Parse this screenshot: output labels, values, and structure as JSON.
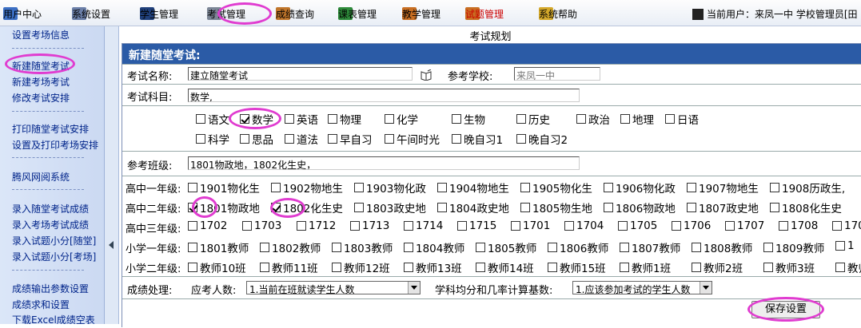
{
  "topnav": {
    "items": [
      {
        "label": "用户中心",
        "icon": "users-icon",
        "color": "#3b6fc4"
      },
      {
        "label": "系统设置",
        "icon": "settings-icon",
        "color": "#6b7fa8"
      },
      {
        "label": "学生管理",
        "icon": "student-icon",
        "color": "#1f3f7a"
      },
      {
        "label": "考试管理",
        "icon": "exam-icon",
        "color": "#7b8595"
      },
      {
        "label": "成绩查询",
        "icon": "score-icon",
        "color": "#c0752a"
      },
      {
        "label": "课表管理",
        "icon": "timetable-icon",
        "color": "#2d8a3a"
      },
      {
        "label": "教学管理",
        "icon": "teaching-icon",
        "color": "#c86e22"
      },
      {
        "label": "试题管理",
        "icon": "question-bank-icon",
        "color": "#c86e22"
      },
      {
        "label": "系统帮助",
        "icon": "help-icon",
        "color": "#d4a82a"
      }
    ],
    "user_info": "当前用户：来凤一中 学校管理员[田"
  },
  "sidebar": {
    "items": [
      "设置考场信息",
      "新建随堂考试",
      "新建考场考试",
      "修改考试安排",
      "打印随堂考试安排",
      "设置及打印考场安排",
      "腾风网阅系统",
      "录入随堂考试成绩",
      "录入考场考试成绩",
      "录入试题小分[随堂]",
      "录入试题小分[考场]",
      "成绩输出参数设置",
      "成绩求和设置",
      "下载Excel成绩空表"
    ]
  },
  "page": {
    "title": "考试规划",
    "panel_title": "新建随堂考试:",
    "exam_name_label": "考试名称:",
    "exam_name_value": "建立随堂考试",
    "school_label": "参考学校:",
    "school_value": "来凤一中",
    "subjects_label": "考试科目:",
    "subjects_value": "数学,",
    "classes_label": "参考班级:",
    "classes_value": "1801物政地，1802化生史，",
    "score_label": "成绩处理:",
    "exam_count_label": "应考人数:",
    "exam_count_value": "1.当前在班就读学生人数",
    "avg_label": "学科均分和几率计算基数:",
    "avg_value": "1.应该参加考试的学生人数",
    "save_label": "保存设置"
  },
  "subjects_row1": [
    {
      "label": "语文",
      "checked": false
    },
    {
      "label": "数学",
      "checked": true
    },
    {
      "label": "英语",
      "checked": false
    },
    {
      "label": "物理",
      "checked": false
    },
    {
      "label": "化学",
      "checked": false
    },
    {
      "label": "生物",
      "checked": false
    },
    {
      "label": "历史",
      "checked": false
    },
    {
      "label": "政治",
      "checked": false
    },
    {
      "label": "地理",
      "checked": false
    },
    {
      "label": "日语",
      "checked": false
    }
  ],
  "subjects_row2": [
    {
      "label": "科学",
      "checked": false
    },
    {
      "label": "思品",
      "checked": false
    },
    {
      "label": "道法",
      "checked": false
    },
    {
      "label": "早自习",
      "checked": false
    },
    {
      "label": "午间时光",
      "checked": false
    },
    {
      "label": "晚自习1",
      "checked": false
    },
    {
      "label": "晚自习2",
      "checked": false
    }
  ],
  "grades": [
    {
      "label": "高中一年级:",
      "classes": [
        {
          "label": "1901物化生",
          "checked": false
        },
        {
          "label": "1902物地生",
          "checked": false
        },
        {
          "label": "1903物化政",
          "checked": false
        },
        {
          "label": "1904物地生",
          "checked": false
        },
        {
          "label": "1905物化生",
          "checked": false
        },
        {
          "label": "1906物化政",
          "checked": false
        },
        {
          "label": "1907物地生",
          "checked": false
        },
        {
          "label": "1908历政生,",
          "checked": false
        }
      ]
    },
    {
      "label": "高中二年级:",
      "classes": [
        {
          "label": "1801物政地",
          "checked": true
        },
        {
          "label": "1802化生史",
          "checked": true
        },
        {
          "label": "1803政史地",
          "checked": false
        },
        {
          "label": "1804政史地",
          "checked": false
        },
        {
          "label": "1805物生地",
          "checked": false
        },
        {
          "label": "1806物政地",
          "checked": false
        },
        {
          "label": "1807政史地",
          "checked": false
        },
        {
          "label": "1808化生史",
          "checked": false
        }
      ]
    },
    {
      "label": "高中三年级:",
      "classes": [
        {
          "label": "1702",
          "checked": false
        },
        {
          "label": "1703",
          "checked": false
        },
        {
          "label": "1712",
          "checked": false
        },
        {
          "label": "1713",
          "checked": false
        },
        {
          "label": "1714",
          "checked": false
        },
        {
          "label": "1715",
          "checked": false
        },
        {
          "label": "1701",
          "checked": false
        },
        {
          "label": "1704",
          "checked": false
        },
        {
          "label": "1705",
          "checked": false
        },
        {
          "label": "1706",
          "checked": false
        },
        {
          "label": "1707",
          "checked": false
        },
        {
          "label": "1708",
          "checked": false
        },
        {
          "label": "1709",
          "checked": false
        },
        {
          "label": "1710,",
          "checked": false
        }
      ]
    },
    {
      "label": "小学一年级:",
      "classes": [
        {
          "label": "1801教师",
          "checked": false
        },
        {
          "label": "1802教师",
          "checked": false
        },
        {
          "label": "1803教师",
          "checked": false
        },
        {
          "label": "1804教师",
          "checked": false
        },
        {
          "label": "1805教师",
          "checked": false
        },
        {
          "label": "1806教师",
          "checked": false
        },
        {
          "label": "1807教师",
          "checked": false
        },
        {
          "label": "1808教师",
          "checked": false
        },
        {
          "label": "1809教师",
          "checked": false
        },
        {
          "label": "1",
          "checked": false
        }
      ]
    },
    {
      "label": "小学二年级:",
      "classes": [
        {
          "label": "教师10班",
          "checked": false
        },
        {
          "label": "教师11班",
          "checked": false
        },
        {
          "label": "教师12班",
          "checked": false
        },
        {
          "label": "教师13班",
          "checked": false
        },
        {
          "label": "教师14班",
          "checked": false
        },
        {
          "label": "教师15班",
          "checked": false
        },
        {
          "label": "教师1班",
          "checked": false
        },
        {
          "label": "教师2班",
          "checked": false
        },
        {
          "label": "教师3班",
          "checked": false
        },
        {
          "label": "教师4",
          "checked": false
        }
      ]
    }
  ],
  "colors": {
    "header_blue": "#2b5ba6",
    "highlight": "#e03cd0",
    "sidebar_link": "#00248a",
    "nav_red": "#cc0000"
  }
}
